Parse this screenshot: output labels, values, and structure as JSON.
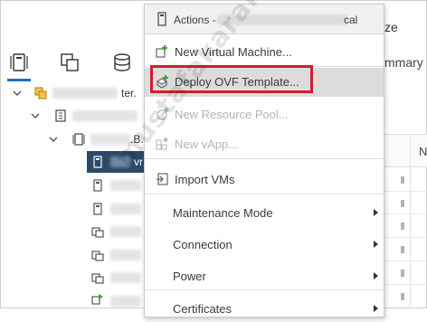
{
  "navigator": {
    "tabs": [
      {
        "icon": "hosts-clusters-icon",
        "active": true
      },
      {
        "icon": "vms-templates-icon",
        "active": false
      },
      {
        "icon": "storage-icon",
        "active": false
      }
    ],
    "tree": [
      {
        "icon": "vcenter-icon",
        "suffix": "ter.",
        "expanded": true
      },
      {
        "icon": "datacenter-icon",
        "suffix": "",
        "expanded": true
      },
      {
        "icon": "host-icon",
        "suffix": ".B.",
        "expanded": true
      },
      {
        "icon": "vm-icon",
        "suffix": "vr",
        "selected": true
      },
      {
        "icon": "vm-icon",
        "suffix": ""
      },
      {
        "icon": "vm-icon",
        "suffix": ""
      },
      {
        "icon": "vm-group-icon",
        "suffix": ""
      },
      {
        "icon": "vm-group-icon",
        "suffix": ""
      },
      {
        "icon": "vm-group-icon",
        "suffix": ""
      },
      {
        "icon": "vm-running-icon",
        "suffix": ""
      }
    ]
  },
  "right_panel": {
    "title_fragment": "ze",
    "tab_fragment": "mmary",
    "column_fragment": "N"
  },
  "context_menu": {
    "header_prefix": "Actions -",
    "header_suffix": "cal",
    "items": [
      {
        "label": "New Virtual Machine...",
        "icon": "new-vm-icon",
        "enabled": true,
        "submenu": false,
        "separator": true
      },
      {
        "label": "Deploy OVF Template...",
        "icon": "deploy-ovf-icon",
        "enabled": true,
        "submenu": false,
        "separator": true,
        "highlighted": true
      },
      {
        "label": "New Resource Pool...",
        "icon": "new-resource-pool-icon",
        "enabled": false,
        "submenu": false,
        "separator": false
      },
      {
        "label": "New vApp...",
        "icon": "new-vapp-icon",
        "enabled": false,
        "submenu": false,
        "separator": true
      },
      {
        "label": "Import VMs",
        "icon": "import-vms-icon",
        "enabled": true,
        "submenu": false,
        "separator": true
      },
      {
        "label": "Maintenance Mode",
        "icon": "",
        "enabled": true,
        "submenu": true,
        "separator": false
      },
      {
        "label": "Connection",
        "icon": "",
        "enabled": true,
        "submenu": true,
        "separator": false
      },
      {
        "label": "Power",
        "icon": "",
        "enabled": true,
        "submenu": true,
        "separator": true
      },
      {
        "label": "Certificates",
        "icon": "",
        "enabled": true,
        "submenu": true,
        "separator": false
      }
    ]
  },
  "watermark": "mustafakarakoulu.com",
  "colors": {
    "selection": "#2c4a68",
    "tab_accent": "#1a6ec8",
    "highlight_box": "#d31f26",
    "icon_green": "#3aa235"
  }
}
